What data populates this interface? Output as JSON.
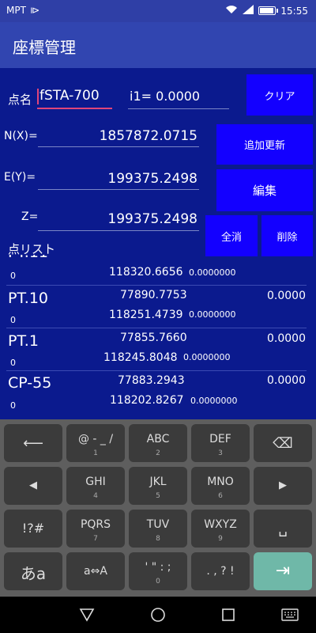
{
  "status_bar": {
    "carrier": "MPT",
    "time": "15:55"
  },
  "app_bar": {
    "title": "座標管理"
  },
  "form": {
    "name_label": "点名",
    "name_value": "fSTA-700",
    "i1_value": "i1= 0.0000",
    "clear_label": "クリア",
    "n_label": "N(X)=",
    "n_value": "1857872.0715",
    "add_update_label": "追加更新",
    "e_label": "E(Y)=",
    "e_value": "199375.2498",
    "edit_label": "編集",
    "z_label": "Z=",
    "z_value": "199375.2498",
    "delete_all_label": "全消",
    "delete_label": "削除"
  },
  "list": {
    "title": "点リスト",
    "partial_row": {
      "zero": "0",
      "e": "118320.6656",
      "z": "0.0000000"
    },
    "rows": [
      {
        "name": "PT.10",
        "n": "77890.7753",
        "h": "0.0000",
        "zero": "0",
        "e": "118251.4739",
        "z": "0.0000000"
      },
      {
        "name": "PT.1",
        "n": "77855.7660",
        "h": "0.0000",
        "zero": "0",
        "e": "118245.8048",
        "z": "0.0000000"
      },
      {
        "name": "CP-55",
        "n": "77883.2943",
        "h": "0.0000",
        "zero": "0",
        "e": "118202.8267",
        "z": "0.0000000"
      }
    ]
  },
  "keyboard": {
    "row1": [
      {
        "icon": "back-arrow-icon",
        "glyph": "⟵"
      },
      {
        "main": "@ - _ /",
        "sub": "1"
      },
      {
        "main": "ABC",
        "sub": "2"
      },
      {
        "main": "DEF",
        "sub": "3"
      },
      {
        "icon": "backspace-icon",
        "glyph": "⌫"
      }
    ],
    "row2": [
      {
        "icon": "left-arrow-icon",
        "glyph": "◀"
      },
      {
        "main": "GHI",
        "sub": "4"
      },
      {
        "main": "JKL",
        "sub": "5"
      },
      {
        "main": "MNO",
        "sub": "6"
      },
      {
        "icon": "right-arrow-icon",
        "glyph": "▶"
      }
    ],
    "row3": [
      {
        "main": "!?#"
      },
      {
        "main": "PQRS",
        "sub": "7"
      },
      {
        "main": "TUV",
        "sub": "8"
      },
      {
        "main": "WXYZ",
        "sub": "9"
      },
      {
        "icon": "space-icon",
        "glyph": "␣"
      }
    ],
    "row4": [
      {
        "main": "あa"
      },
      {
        "main": "a⇔A"
      },
      {
        "main": "' \" : ;",
        "sub": "0"
      },
      {
        "main": ". , ? !"
      },
      {
        "icon": "enter-icon",
        "glyph": "⇥"
      }
    ]
  },
  "colors": {
    "accent": "#1300ff",
    "background": "#0b1a8e",
    "appbar": "#3145b0",
    "enter_key": "#6fb8a8"
  }
}
